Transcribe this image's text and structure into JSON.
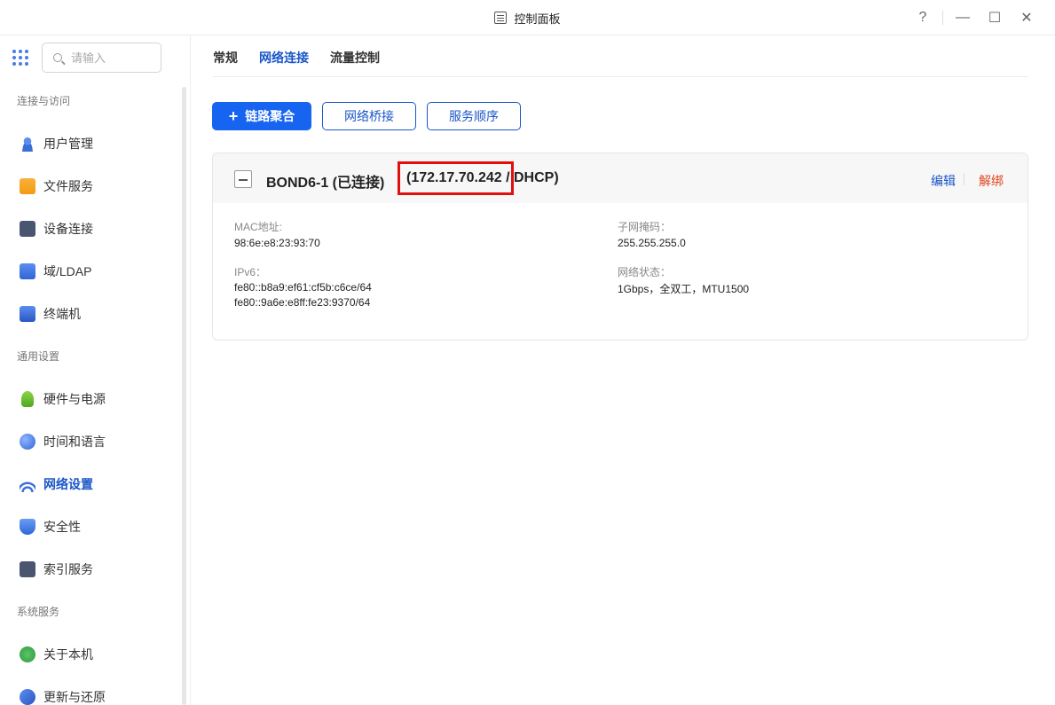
{
  "window": {
    "title": "控制面板",
    "help": "?",
    "minimize": "—",
    "maximize": "☐",
    "close": "✕"
  },
  "search": {
    "placeholder": "请输入"
  },
  "sidebar": {
    "sections": [
      {
        "label": "连接与访问"
      },
      {
        "label": "通用设置"
      },
      {
        "label": "系统服务"
      }
    ],
    "items": [
      {
        "label": "用户管理",
        "icon": "users-icon"
      },
      {
        "label": "文件服务",
        "icon": "folder-icon"
      },
      {
        "label": "设备连接",
        "icon": "device-icon"
      },
      {
        "label": "域/LDAP",
        "icon": "ldap-icon"
      },
      {
        "label": "终端机",
        "icon": "terminal-icon"
      },
      {
        "label": "硬件与电源",
        "icon": "power-icon"
      },
      {
        "label": "时间和语言",
        "icon": "globe-icon"
      },
      {
        "label": "网络设置",
        "icon": "wifi-icon",
        "active": true
      },
      {
        "label": "安全性",
        "icon": "shield-icon"
      },
      {
        "label": "索引服务",
        "icon": "index-icon"
      },
      {
        "label": "关于本机",
        "icon": "info-icon"
      },
      {
        "label": "更新与还原",
        "icon": "refresh-icon"
      }
    ]
  },
  "tabs": [
    {
      "label": "常规"
    },
    {
      "label": "网络连接",
      "active": true
    },
    {
      "label": "流量控制"
    }
  ],
  "actions": {
    "link_aggregation": "链路聚合",
    "network_bridge": "网络桥接",
    "service_order": "服务顺序"
  },
  "interface": {
    "name": "BOND6-1 (已连接)",
    "ip": "(172.17.70.242 / DHCP)",
    "edit": "编辑",
    "unbind": "解绑",
    "mac_label": "MAC地址:",
    "mac_value": "98:6e:e8:23:93:70",
    "ipv6_label": "IPv6：",
    "ipv6_values": [
      "fe80::b8a9:ef61:cf5b:c6ce/64",
      "fe80::9a6e:e8ff:fe23:9370/64"
    ],
    "mask_label": "子网掩码：",
    "mask_value": "255.255.255.0",
    "status_label": "网络状态：",
    "status_value": "1Gbps，全双工，MTU1500"
  },
  "colors": {
    "accent": "#1664f0",
    "link": "#1a56c8",
    "danger": "#e0451e",
    "highlight": "#e0100e"
  }
}
